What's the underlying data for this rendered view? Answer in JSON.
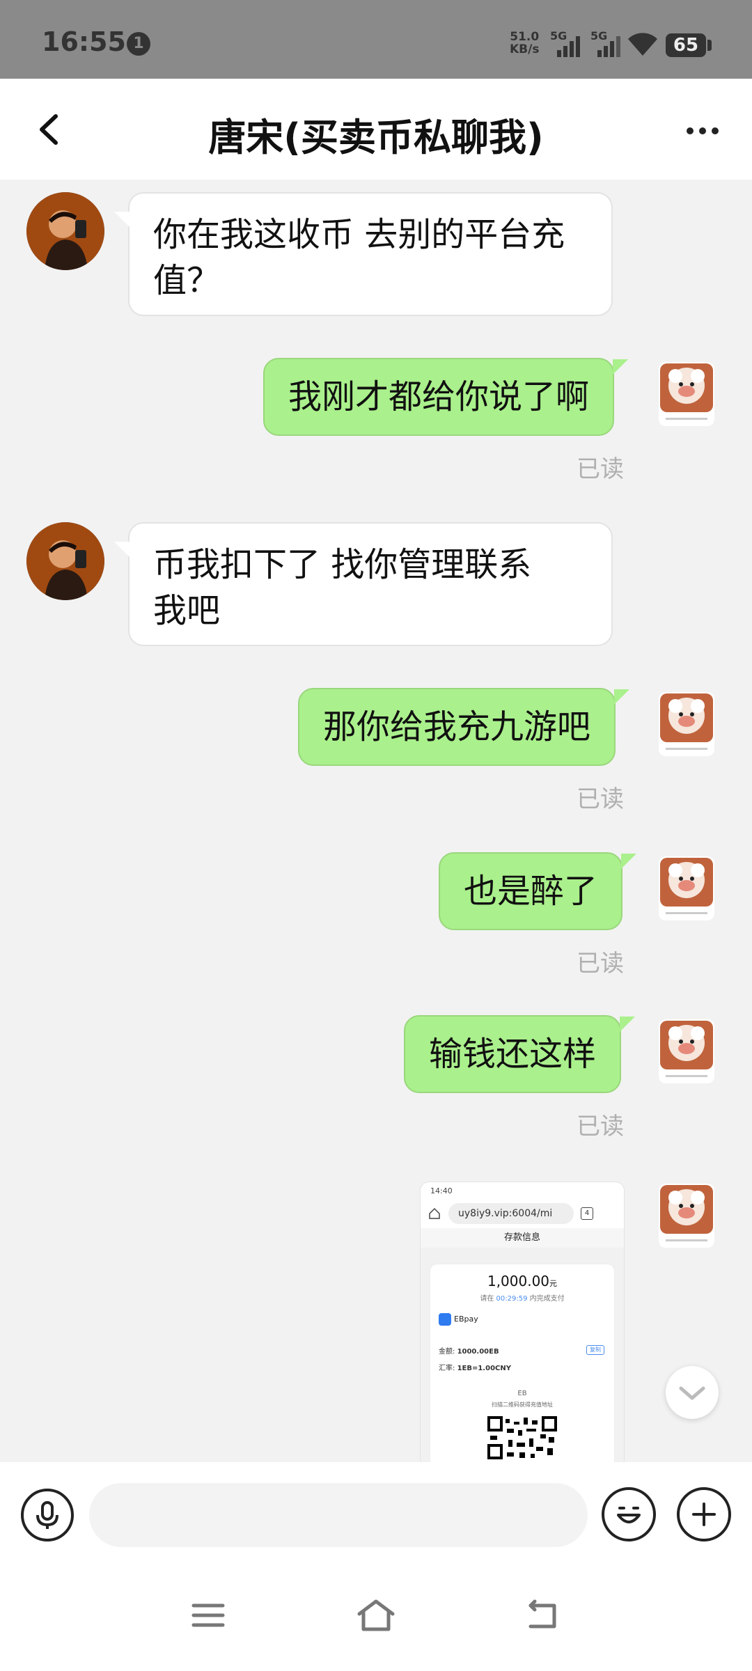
{
  "status_bar": {
    "time": "16:55",
    "notification_count": "1",
    "net_speed_value": "51.0",
    "net_speed_unit": "KB/s",
    "sim1_label": "5G",
    "sim2_label": "5G",
    "battery": "65"
  },
  "header": {
    "title": "唐宋(买卖币私聊我)",
    "back_icon": "chevron-left-icon",
    "more_icon": "more-dots-icon"
  },
  "messages": [
    {
      "side": "left",
      "text_line1": "你在我这收币 去别的平台充",
      "text_line2": "值？"
    },
    {
      "side": "right",
      "text": "我刚才都给你说了啊",
      "status": "已读"
    },
    {
      "side": "left",
      "text_line1": "币我扣下了  找你管理联系",
      "text_line2": "我吧"
    },
    {
      "side": "right",
      "text": "那你给我充九游吧",
      "status": "已读"
    },
    {
      "side": "right",
      "text": "也是醉了",
      "status": "已读"
    },
    {
      "side": "right",
      "text": "输钱还这样",
      "status": "已读"
    }
  ],
  "screenshot_message": {
    "time": "14:40",
    "url": "uy8iy9.vip:6004/mi",
    "tab_count": "4",
    "page_title": "存款信息",
    "amount": "1,000.00",
    "amount_unit": "元",
    "hint_prefix": "请在",
    "countdown": "00:29:59",
    "hint_suffix": "内完成支付",
    "pay_method": "EBpay",
    "amount_label": "金额:",
    "amount_value": "1000.00EB",
    "copy_label": "复制",
    "rate_label": "汇率:",
    "rate_value": "1EB=1.00CNY",
    "currency": "EB",
    "scan_hint": "扫描二维码获得充值地址"
  },
  "input_bar": {
    "placeholder": "",
    "voice_icon": "microphone-icon",
    "emoji_icon": "emoji-icon",
    "plus_icon": "plus-icon"
  },
  "colors": {
    "sent_bubble": "#aaf08c",
    "received_bubble": "#ffffff",
    "background": "#f2f2f2",
    "status_bar": "#8a8a8a"
  }
}
